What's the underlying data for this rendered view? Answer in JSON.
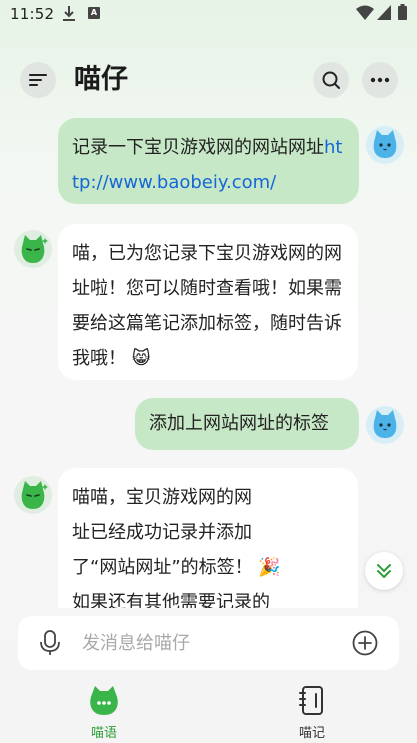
{
  "status_bar": {
    "time": "11:52",
    "icons": [
      "download-icon",
      "a-badge-icon",
      "wifi-icon",
      "signal-icon",
      "battery-icon"
    ],
    "a_badge": "A"
  },
  "header": {
    "title": "喵仔",
    "icons": [
      "menu-icon",
      "search-icon",
      "more-icon"
    ]
  },
  "messages": [
    {
      "sender": "user",
      "text": "记录一下宝贝游戏网的网站网址",
      "link": "http://www.baobeiy.com/"
    },
    {
      "sender": "bot",
      "text": "喵，已为您记录下宝贝游戏网的网址啦！您可以随时查看哦！如果需要给这篇笔记添加标签，随时告诉我哦！",
      "emoji": "😸"
    },
    {
      "sender": "user",
      "text": "添加上网站网址的标签"
    },
    {
      "sender": "bot",
      "text_lines": [
        "喵喵，宝贝游戏网的网",
        "址已经成功记录并添加",
        "了“网站网址”的标签！",
        "如果还有其他需要记录的"
      ],
      "emoji": "🎉"
    }
  ],
  "input": {
    "placeholder": "发消息给喵仔",
    "value": ""
  },
  "bottom_nav": [
    {
      "label": "喵语",
      "active": true
    },
    {
      "label": "喵记",
      "active": false
    }
  ],
  "colors": {
    "accent": "#2e9e3a",
    "user_bubble": "#c7e8c7",
    "bot_bubble": "#ffffff",
    "link": "#1566d6"
  }
}
